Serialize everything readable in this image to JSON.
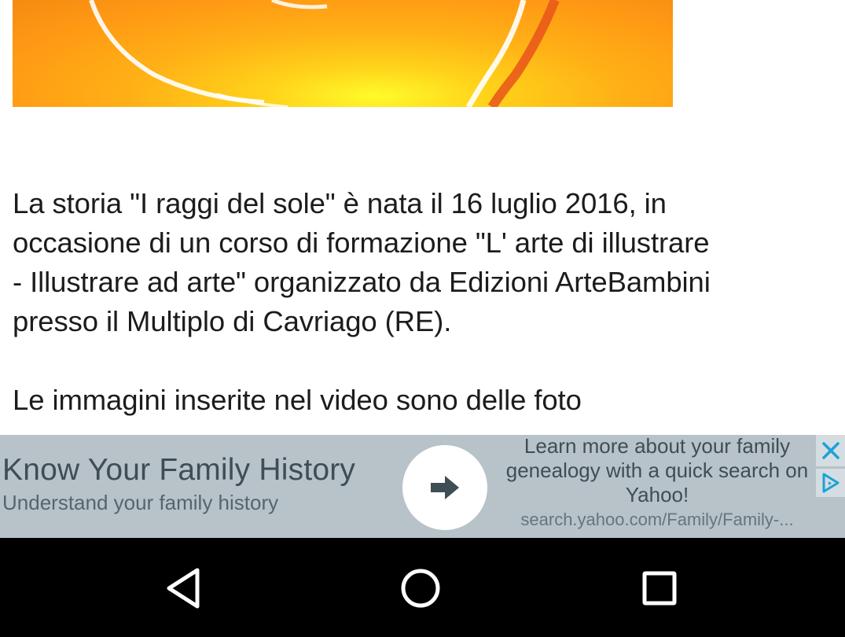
{
  "article": {
    "image_icon": "photo-icon",
    "paragraphs": [
      "La storia \"I raggi del sole\" è nata il 16 luglio 2016, in\noccasione di un corso di formazione \"L' arte di illustrare\n- Illustrare ad arte\" organizzato da Edizioni ArteBambini\npresso il Multiplo di Cavriago (RE).",
      "Le immagini inserite nel video sono delle foto"
    ]
  },
  "ad": {
    "headline": "Know Your Family History",
    "subline": "Understand your family history",
    "description": "Learn more about your family genealogy with a quick search on Yahoo!",
    "url": "search.yahoo.com/Family/Family-...",
    "cta_icon": "arrow-right-icon",
    "close_icon": "close-icon",
    "adchoices_icon": "adchoices-icon",
    "background_color": "#b7c3c9"
  },
  "navigation": {
    "back_icon": "back-triangle-icon",
    "home_icon": "home-circle-icon",
    "recents_icon": "recents-square-icon"
  }
}
